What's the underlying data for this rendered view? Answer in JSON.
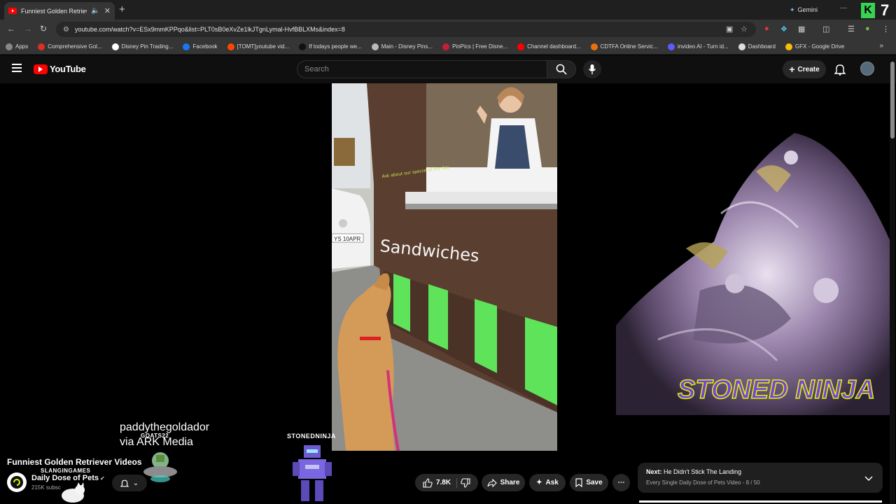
{
  "browser": {
    "tab_title": "Funniest Golden Retriever V",
    "gemini_label": "Gemini",
    "url": "youtube.com/watch?v=ESx9mmKPPqo&list=PLT0sB0eXvZe1lkJTgnLymal-HvfBBLXMs&index=8",
    "corner_number": "7",
    "corner_letter": "K"
  },
  "bookmarks": [
    {
      "label": "Apps",
      "color": "#888888"
    },
    {
      "label": "Comprehensive Gol...",
      "color": "#d93025"
    },
    {
      "label": "Disney Pin Trading...",
      "color": "#ffffff"
    },
    {
      "label": "Facebook",
      "color": "#1877f2"
    },
    {
      "label": "[TOMT]youtube vid...",
      "color": "#ff4500"
    },
    {
      "label": "If todays people we...",
      "color": "#111111"
    },
    {
      "label": "Main - Disney Pins...",
      "color": "#bbbbbb"
    },
    {
      "label": "PinPics | Free Disne...",
      "color": "#c41e3a"
    },
    {
      "label": "Channel dashboard...",
      "color": "#ff0000"
    },
    {
      "label": "CDTFA Online Servic...",
      "color": "#e8710a"
    },
    {
      "label": "invideo AI - Turn id...",
      "color": "#5b5bff"
    },
    {
      "label": "Dashboard",
      "color": "#dddddd"
    },
    {
      "label": "GFX - Google Drive",
      "color": "#fbbc04"
    }
  ],
  "yt": {
    "logo_text": "YouTube",
    "search_placeholder": "Search",
    "create_label": "Create"
  },
  "video": {
    "sign_text": "Sandwiches",
    "plate_text": "YS 10APR",
    "small_sign": "Ask about our special of the day",
    "credit_line1": "paddythegoldador",
    "credit_line2": "via ARK Media",
    "overlay_goats": "GOATS22",
    "overlay_stonedninja": "STONEDNINJA",
    "overlay_slangin": "SLANGINGAMES",
    "overlay_big": "STONED NINJA"
  },
  "info": {
    "title": "Funniest Golden Retriever Videos",
    "channel": "Daily Dose of Pets",
    "subscribers": "215K subsc",
    "likes": "7.8K",
    "share": "Share",
    "ask": "Ask",
    "save": "Save"
  },
  "next": {
    "label": "Next:",
    "title": "He Didn't Stick The Landing",
    "subtitle": "Every Single Daily Dose of Pets Video - 8 / 50"
  },
  "colors": {
    "yt_red": "#ff0000",
    "stall_green": "#5fe35a",
    "stall_brown": "#5a3e2f",
    "ninja_purple": "#7b3fe4",
    "ninja_outline": "#d7f700"
  }
}
